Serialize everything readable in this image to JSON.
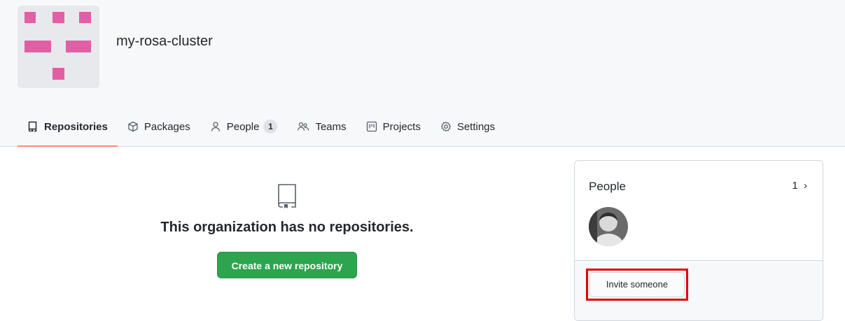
{
  "org": {
    "name": "my-rosa-cluster",
    "avatar_color": "#e05fa5"
  },
  "tabs": [
    {
      "label": "Repositories",
      "icon": "repo-icon",
      "active": true
    },
    {
      "label": "Packages",
      "icon": "package-icon"
    },
    {
      "label": "People",
      "icon": "person-icon",
      "counter": "1"
    },
    {
      "label": "Teams",
      "icon": "people-icon"
    },
    {
      "label": "Projects",
      "icon": "project-icon"
    },
    {
      "label": "Settings",
      "icon": "gear-icon"
    }
  ],
  "empty_state": {
    "icon": "repo-icon",
    "message": "This organization has no repositories.",
    "button": "Create a new repository"
  },
  "people_card": {
    "title": "People",
    "count": "1",
    "invite_button": "Invite someone"
  },
  "colors": {
    "accent_underline": "#fd8c73",
    "primary_button": "#2da44e",
    "highlight": "#e60000"
  }
}
